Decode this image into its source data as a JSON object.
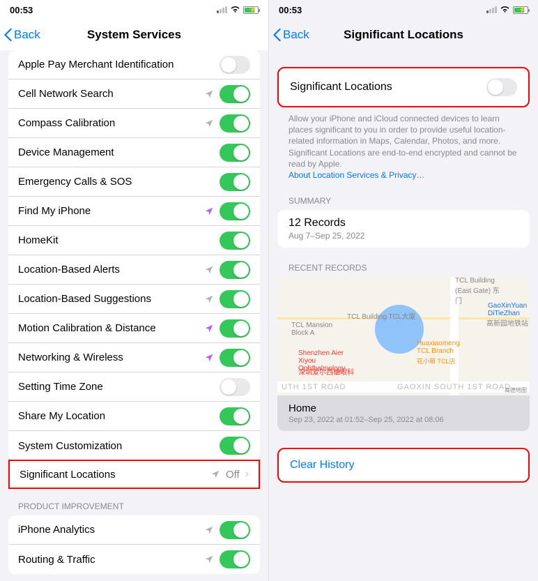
{
  "left": {
    "status_time": "00:53",
    "back_label": "Back",
    "title": "System Services",
    "rows": [
      {
        "label": "Apple Pay Merchant Identification",
        "icon": "none",
        "toggle": "off"
      },
      {
        "label": "Cell Network Search",
        "icon": "gray",
        "toggle": "on"
      },
      {
        "label": "Compass Calibration",
        "icon": "gray",
        "toggle": "on"
      },
      {
        "label": "Device Management",
        "icon": "none",
        "toggle": "on"
      },
      {
        "label": "Emergency Calls & SOS",
        "icon": "none",
        "toggle": "on"
      },
      {
        "label": "Find My iPhone",
        "icon": "purple",
        "toggle": "on"
      },
      {
        "label": "HomeKit",
        "icon": "none",
        "toggle": "on"
      },
      {
        "label": "Location-Based Alerts",
        "icon": "gray",
        "toggle": "on"
      },
      {
        "label": "Location-Based Suggestions",
        "icon": "gray",
        "toggle": "on"
      },
      {
        "label": "Motion Calibration & Distance",
        "icon": "purple",
        "toggle": "on"
      },
      {
        "label": "Networking & Wireless",
        "icon": "purple",
        "toggle": "on"
      },
      {
        "label": "Setting Time Zone",
        "icon": "none",
        "toggle": "off"
      },
      {
        "label": "Share My Location",
        "icon": "none",
        "toggle": "on"
      },
      {
        "label": "System Customization",
        "icon": "none",
        "toggle": "on"
      }
    ],
    "sig_row": {
      "label": "Significant Locations",
      "status": "Off"
    },
    "section_header": "PRODUCT IMPROVEMENT",
    "rows2": [
      {
        "label": "iPhone Analytics",
        "icon": "gray",
        "toggle": "on"
      },
      {
        "label": "Routing & Traffic",
        "icon": "gray",
        "toggle": "on"
      }
    ]
  },
  "right": {
    "status_time": "00:53",
    "back_label": "Back",
    "title": "Significant Locations",
    "toggle_label": "Significant Locations",
    "desc": "Allow your iPhone and iCloud connected devices to learn places significant to you in order to provide useful location-related information in Maps, Calendar, Photos, and more. Significant Locations are end-to-end encrypted and cannot be read by Apple.",
    "link": "About Location Services & Privacy…",
    "summary_header": "SUMMARY",
    "summary_title": "12 Records",
    "summary_sub": "Aug 7–Sep 25, 2022",
    "recent_header": "RECENT RECORDS",
    "map": {
      "labels": {
        "tcl_mansion": "TCL Mansion Block A",
        "tcl_building": "TCL Building TCL大厦",
        "tcl_east": "TCL Building (East Gate) 东门",
        "gaoxin": "GaoXinYuan DiTieZhan",
        "gaoxin_cn": "高新园地铁站",
        "shenzhen": "Shenzhen Aier Xiyou Ophthalmology",
        "shenzhen_cn": "深圳爱尔西柚眼科",
        "hua": "Huaxiaomeng TCL Branch",
        "hua_cn": "花小萌 TCL店",
        "roadL": "UTH 1ST ROAD",
        "roadR": "GAOXIN SOUTH 1ST ROAD",
        "gaode": "高德地图"
      },
      "footer_title": "Home",
      "footer_sub": "Sep 23, 2022 at 01:52–Sep 25, 2022 at 08:06"
    },
    "clear": "Clear History"
  }
}
